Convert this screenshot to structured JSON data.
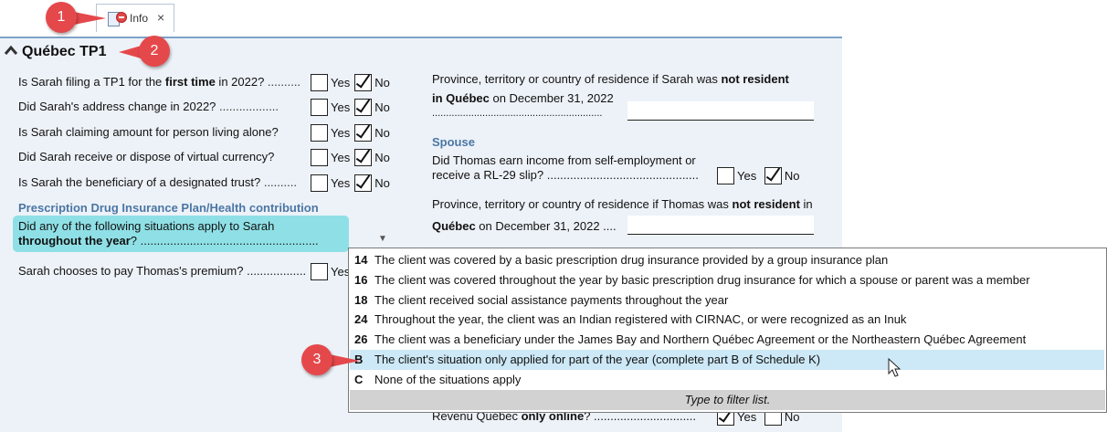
{
  "tab": {
    "label": "Info",
    "close": "×"
  },
  "section": {
    "title": "Québec TP1"
  },
  "yes": "Yes",
  "no": "No",
  "left_questions": [
    {
      "pre": "Is Sarah filing a TP1 for the ",
      "bold": "first time",
      "post": " in 2022?",
      "dots": " ..........",
      "yes": false,
      "no": true
    },
    {
      "pre": "Did Sarah's address change in 2022?",
      "bold": "",
      "post": "",
      "dots": " ..................",
      "yes": false,
      "no": true
    },
    {
      "pre": "Is Sarah claiming amount for person living alone?",
      "bold": "",
      "post": "",
      "dots": "",
      "yes": false,
      "no": true
    },
    {
      "pre": "Did Sarah receive or dispose of virtual currency?",
      "bold": "",
      "post": "",
      "dots": "",
      "yes": false,
      "no": true
    },
    {
      "pre": "Is Sarah the beneficiary of a designated trust?",
      "bold": "",
      "post": "",
      "dots": " ..........",
      "yes": false,
      "no": true
    }
  ],
  "pdip": {
    "heading": "Prescription Drug Insurance Plan/Health contribution",
    "q_line1": "Did any of the following situations apply to Sarah",
    "q_bold": "throughout the year",
    "q_post": "? ......................................................",
    "premium_q": "Sarah chooses to pay Thomas's premium?",
    "premium_dots": " ..................",
    "premium_yes": "Yes"
  },
  "right": {
    "residence_l1_pre": "Province, territory or country of residence if Sarah was ",
    "residence_l1_bold": "not resident",
    "residence_l2_bold": "in Québec",
    "residence_l2_post": " on December 31, 2022",
    "residence_dots": ".............................................................",
    "spouse_heading": "Spouse",
    "spouse_q_l1": "Did Thomas earn income from self-employment or",
    "spouse_q_l2": "receive a RL-29 slip?",
    "spouse_q_dots": " ..............................................",
    "spouse_yes": false,
    "spouse_no": true,
    "sres_l1_pre": "Province, territory or country of residence if Thomas was ",
    "sres_l1_bold": "not resident",
    "sres_l1_post": " in",
    "sres_l2_bold": "Québec",
    "sres_l2_post": " on December 31, 2022  ....",
    "revenu_pre": "Revenu Québec ",
    "revenu_bold": "only online",
    "revenu_post": "? ...............................",
    "revenu_yes": true,
    "revenu_no": false
  },
  "dropdown": {
    "options": [
      {
        "code": "14",
        "text": "The client was covered by a basic prescription drug insurance provided by a group insurance plan"
      },
      {
        "code": "16",
        "text": "The client was covered throughout the year by basic prescription drug insurance for which a spouse or parent was a member"
      },
      {
        "code": "18",
        "text": "The client received social assistance payments throughout the year"
      },
      {
        "code": "24",
        "text": "Throughout the year, the client was an Indian registered with CIRNAC, or were recognized as an Inuk"
      },
      {
        "code": "26",
        "text": "The client was a beneficiary under the James Bay and Northern Québec Agreement or the Northeastern Québec Agreement"
      },
      {
        "code": "B",
        "text": "The client's situation only applied for part of the year (complete part B of Schedule K)"
      },
      {
        "code": "C",
        "text": "None of the situations apply"
      }
    ],
    "selected_index": 5,
    "filter_hint": "Type to filter list."
  },
  "callouts": [
    "1",
    "2",
    "3"
  ],
  "colors": {
    "accent": "#4b76a4",
    "highlight": "#8fe0e6",
    "callout": "#e5484b",
    "selected": "#cde8f6"
  }
}
